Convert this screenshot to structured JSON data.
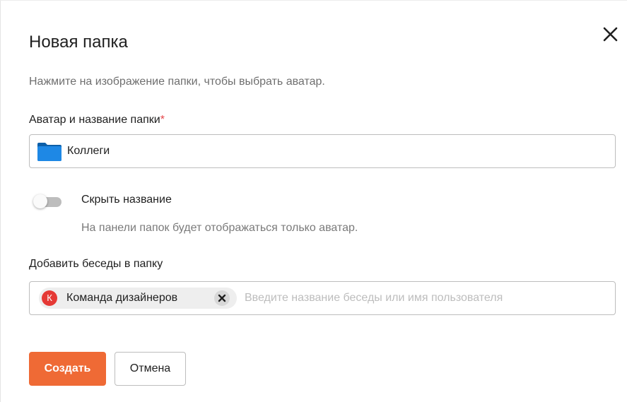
{
  "dialog": {
    "title": "Новая папка",
    "close_icon": "close-icon",
    "hint": "Нажмите на изображение папки, чтобы выбрать аватар."
  },
  "folder": {
    "label": "Аватар и название папки",
    "required_mark": "*",
    "avatar_icon": "folder-icon",
    "avatar_color": "#1e88e5",
    "name_value": "Коллеги"
  },
  "hide_name": {
    "title": "Скрыть название",
    "description": "На панели папок будет отображаться только аватар.",
    "enabled": false
  },
  "chats": {
    "label": "Добавить беседы в папку",
    "placeholder": "Введите название беседы или имя пользователя",
    "selected": [
      {
        "avatar_letter": "К",
        "avatar_color": "#e53935",
        "name": "Команда дизайнеров",
        "remove_icon": "close-icon"
      }
    ]
  },
  "actions": {
    "create_label": "Создать",
    "create_color": "#ef6a35",
    "cancel_label": "Отмена"
  },
  "colors": {
    "required": "#e5474b",
    "border": "#bdbdbd",
    "hint_text": "#6f6f6f"
  }
}
